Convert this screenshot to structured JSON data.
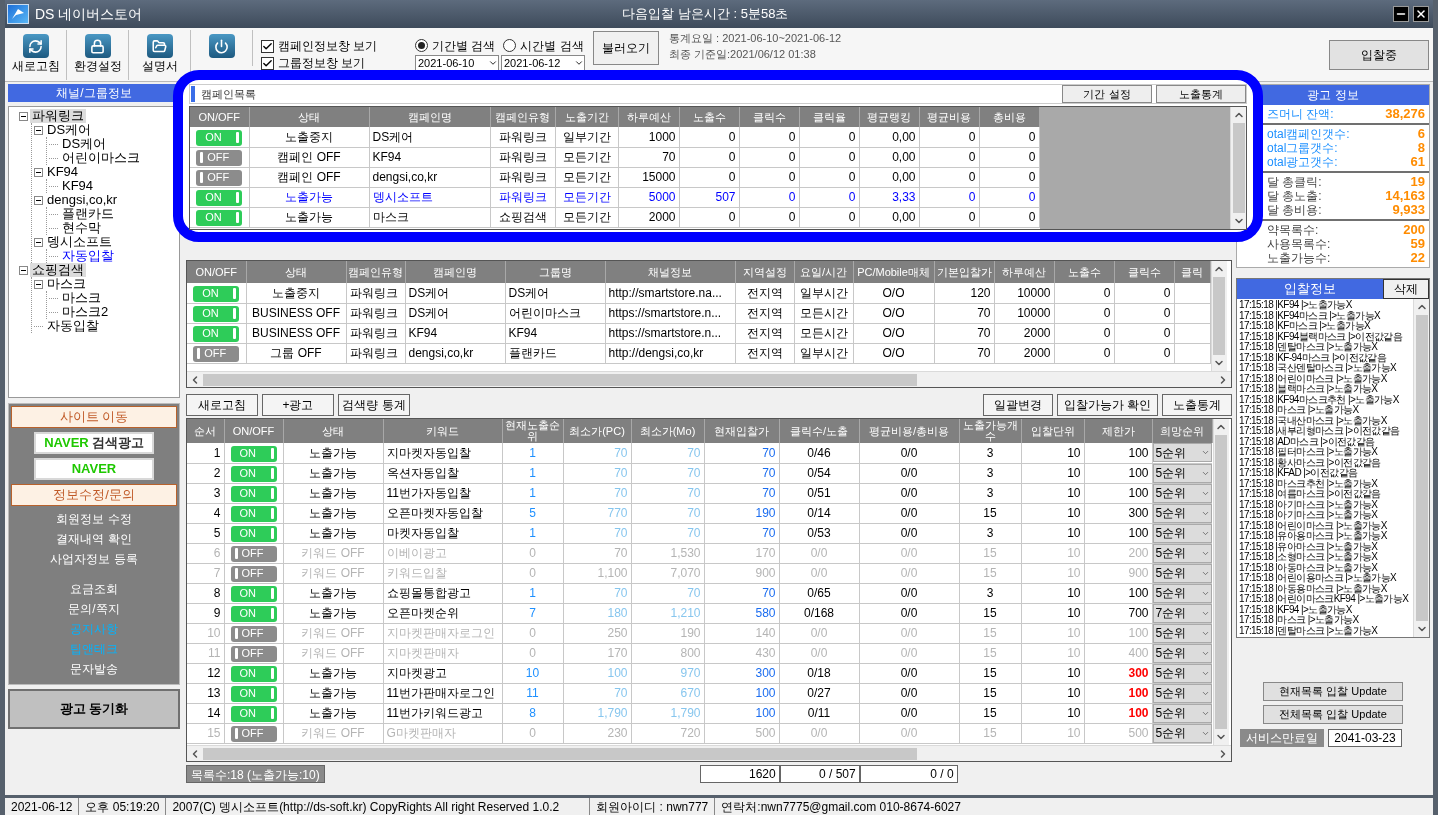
{
  "window": {
    "title": "DS 네이버스토어",
    "countdown": "다음입찰 남은시간 : 5분58초"
  },
  "toolbar": {
    "buttons": [
      {
        "kind": "refresh",
        "label": "새로고침"
      },
      {
        "kind": "settings",
        "label": "환경설정"
      },
      {
        "kind": "manual",
        "label": "설명서"
      },
      {
        "kind": "power"
      }
    ],
    "view_options": [
      {
        "label": "캠페인정보창 보기",
        "checked": true
      },
      {
        "label": "그룹정보창 보기",
        "checked": true
      }
    ],
    "search_mode": [
      {
        "label": "기간별 검색",
        "selected": true
      },
      {
        "label": "시간별 검색",
        "selected": false
      }
    ],
    "dates": [
      "2021-06-10",
      "2021-06-12"
    ],
    "load_button": "불러오기",
    "stats_period": "통계요일 : 2021-06-10~2021-06-12",
    "last_update": "최종 기준일:2021/06/12 01:38",
    "bid_status_button": "입찰중"
  },
  "sidebar": {
    "title": "채널/그룹정보",
    "tree": [
      {
        "label": "파워링크",
        "selected": false,
        "expanded": true,
        "children": [
          {
            "label": "DS케어",
            "selected": false,
            "expanded": true,
            "children": [
              {
                "label": "DS케어",
                "selected": false
              },
              {
                "label": "어린이마스크",
                "selected": false
              }
            ]
          },
          {
            "label": "KF94",
            "selected": false,
            "expanded": true,
            "children": [
              {
                "label": "KF94",
                "selected": false
              }
            ]
          },
          {
            "label": "dengsi,co,kr",
            "selected": false,
            "expanded": true,
            "children": [
              {
                "label": "플랜카드",
                "selected": false
              },
              {
                "label": "현수막",
                "selected": false
              }
            ]
          },
          {
            "label": "뎅시소프트",
            "selected": false,
            "expanded": true,
            "children": [
              {
                "label": "자동입찰",
                "selected": true
              }
            ]
          }
        ]
      },
      {
        "label": "쇼핑검색",
        "selected": false,
        "expanded": true,
        "children": [
          {
            "label": "마스크",
            "selected": false,
            "expanded": true,
            "children": [
              {
                "label": "마스크",
                "selected": false
              },
              {
                "label": "마스크2",
                "selected": false
              }
            ]
          },
          {
            "label": "자동입찰",
            "selected": false
          }
        ]
      }
    ]
  },
  "nav": {
    "site_header": "사이트 이동",
    "site_links": [
      {
        "brand": "NAVER",
        "suffix": "검색광고"
      },
      {
        "brand": "NAVER"
      }
    ],
    "info_header": "정보수정/문의",
    "link_groups": [
      [
        {
          "label": "회원정보 수정",
          "highlight": false
        },
        {
          "label": "결재내역 확인",
          "highlight": false
        },
        {
          "label": "사업자정보 등록",
          "highlight": false
        }
      ],
      [
        {
          "label": "요금조회",
          "highlight": false
        },
        {
          "label": "문의/쪽지",
          "highlight": false
        },
        {
          "label": "공지사항",
          "highlight": true
        },
        {
          "label": "팁앤테크",
          "highlight": true
        },
        {
          "label": "문자발송",
          "highlight": false
        }
      ]
    ],
    "sync_button": "광고 동기화"
  },
  "campaign_list": {
    "title": "캠페인목록",
    "buttons": [
      "기간 설정",
      "노출통계"
    ],
    "columns": [
      "ON/OFF",
      "상태",
      "캠페인명",
      "캠페인유형",
      "노출기간",
      "하루예산",
      "노출수",
      "클릭수",
      "클릭율",
      "평균랭킹",
      "평균비용",
      "총비용"
    ],
    "rows": [
      {
        "on": true,
        "selected": false,
        "cells": [
          "ON",
          "노출중지",
          "DS케어",
          "파워링크",
          "일부기간",
          "1000",
          "0",
          "0",
          "0",
          "0,00",
          "0",
          "0"
        ]
      },
      {
        "on": false,
        "selected": false,
        "cells": [
          "OFF",
          "캠페인 OFF",
          "KF94",
          "파워링크",
          "모든기간",
          "70",
          "0",
          "0",
          "0",
          "0,00",
          "0",
          "0"
        ]
      },
      {
        "on": false,
        "selected": false,
        "cells": [
          "OFF",
          "캠페인 OFF",
          "dengsi,co,kr",
          "파워링크",
          "모든기간",
          "15000",
          "0",
          "0",
          "0",
          "0,00",
          "0",
          "0"
        ]
      },
      {
        "on": true,
        "selected": true,
        "cells": [
          "ON",
          "노출가능",
          "뎅시소프트",
          "파워링크",
          "모든기간",
          "5000",
          "507",
          "0",
          "0",
          "3,33",
          "0",
          "0"
        ]
      },
      {
        "on": true,
        "selected": false,
        "cells": [
          "ON",
          "노출가능",
          "마스크",
          "쇼핑검색",
          "모든기간",
          "2000",
          "0",
          "0",
          "0",
          "0,00",
          "0",
          "0"
        ]
      }
    ]
  },
  "group_table": {
    "columns": [
      "ON/OFF",
      "상태",
      "캠페인유형",
      "캠페인명",
      "그룹명",
      "채널정보",
      "지역설정",
      "요일/시간",
      "PC/Mobile매체",
      "기본입찰가",
      "하루예산",
      "노출수",
      "클릭수",
      "클릭"
    ],
    "rows": [
      {
        "on": true,
        "cells": [
          "ON",
          "노출중지",
          "파워링크",
          "DS케어",
          "DS케어",
          "http://smartstore.na...",
          "전지역",
          "일부시간",
          "O/O",
          "120",
          "10000",
          "0",
          "0"
        ]
      },
      {
        "on": true,
        "cells": [
          "ON",
          "BUSINESS OFF",
          "파워링크",
          "DS케어",
          "어린이마스크",
          "https://smartstore.n...",
          "전지역",
          "모든시간",
          "O/O",
          "70",
          "10000",
          "0",
          "0"
        ]
      },
      {
        "on": true,
        "cells": [
          "ON",
          "BUSINESS OFF",
          "파워링크",
          "KF94",
          "KF94",
          "https://smartstore.n...",
          "전지역",
          "모든시간",
          "O/O",
          "70",
          "2000",
          "0",
          "0"
        ]
      },
      {
        "on": false,
        "cells": [
          "OFF",
          "그룹 OFF",
          "파워링크",
          "dengsi,co,kr",
          "플랜카드",
          "http://dengsi,co,kr",
          "전지역",
          "일부시간",
          "O/O",
          "70",
          "2000",
          "0",
          "0"
        ]
      }
    ]
  },
  "keyword_actions": {
    "left": [
      "새로고침",
      "+광고",
      "검색량 통계"
    ],
    "right": [
      "일괄변경",
      "입찰가능가 확인",
      "노출통계"
    ]
  },
  "keyword_table": {
    "columns": [
      "순서",
      "ON/OFF",
      "상태",
      "키워드",
      "현재노출순위",
      "최소가(PC)",
      "최소가(Mo)",
      "현재입찰가",
      "클릭수/노출",
      "평균비용/총비용",
      "노출가능개수",
      "입찰단위",
      "제한가",
      "희망순위"
    ],
    "rows": [
      {
        "on": true,
        "limit_alert": false,
        "cells": [
          "1",
          "ON",
          "노출가능",
          "지마켓자동입찰",
          "1",
          "70",
          "70",
          "70",
          "0/46",
          "0/0",
          "3",
          "10",
          "100",
          "5순위"
        ]
      },
      {
        "on": true,
        "limit_alert": false,
        "cells": [
          "2",
          "ON",
          "노출가능",
          "옥션자동입찰",
          "1",
          "70",
          "70",
          "70",
          "0/54",
          "0/0",
          "3",
          "10",
          "100",
          "5순위"
        ]
      },
      {
        "on": true,
        "limit_alert": false,
        "cells": [
          "3",
          "ON",
          "노출가능",
          "11번가자동입찰",
          "1",
          "70",
          "70",
          "70",
          "0/51",
          "0/0",
          "3",
          "10",
          "100",
          "5순위"
        ]
      },
      {
        "on": true,
        "limit_alert": false,
        "cells": [
          "4",
          "ON",
          "노출가능",
          "오픈마켓자동입찰",
          "5",
          "770",
          "70",
          "190",
          "0/14",
          "0/0",
          "15",
          "10",
          "300",
          "5순위"
        ]
      },
      {
        "on": true,
        "limit_alert": false,
        "cells": [
          "5",
          "ON",
          "노출가능",
          "마켓자동입찰",
          "1",
          "70",
          "70",
          "70",
          "0/53",
          "0/0",
          "3",
          "10",
          "100",
          "5순위"
        ]
      },
      {
        "on": false,
        "limit_alert": false,
        "cells": [
          "6",
          "OFF",
          "키워드 OFF",
          "이베이광고",
          "0",
          "70",
          "1,530",
          "170",
          "0/0",
          "0/0",
          "15",
          "10",
          "200",
          "5순위"
        ]
      },
      {
        "on": false,
        "limit_alert": false,
        "cells": [
          "7",
          "OFF",
          "키워드 OFF",
          "키워드입찰",
          "0",
          "1,100",
          "7,070",
          "900",
          "0/0",
          "0/0",
          "15",
          "10",
          "900",
          "5순위"
        ]
      },
      {
        "on": true,
        "limit_alert": false,
        "cells": [
          "8",
          "ON",
          "노출가능",
          "쇼핑몰통합광고",
          "1",
          "70",
          "70",
          "70",
          "0/65",
          "0/0",
          "3",
          "10",
          "100",
          "5순위"
        ]
      },
      {
        "on": true,
        "limit_alert": false,
        "cells": [
          "9",
          "ON",
          "노출가능",
          "오픈마켓순위",
          "7",
          "180",
          "1,210",
          "580",
          "0/168",
          "0/0",
          "15",
          "10",
          "700",
          "7순위"
        ]
      },
      {
        "on": false,
        "limit_alert": false,
        "cells": [
          "10",
          "OFF",
          "키워드 OFF",
          "지마켓판매자로그인",
          "0",
          "250",
          "190",
          "140",
          "0/0",
          "0/0",
          "15",
          "10",
          "100",
          "5순위"
        ]
      },
      {
        "on": false,
        "limit_alert": false,
        "cells": [
          "11",
          "OFF",
          "키워드 OFF",
          "지마켓판매자",
          "0",
          "170",
          "800",
          "430",
          "0/0",
          "0/0",
          "15",
          "10",
          "400",
          "5순위"
        ]
      },
      {
        "on": true,
        "limit_alert": true,
        "cells": [
          "12",
          "ON",
          "노출가능",
          "지마켓광고",
          "10",
          "100",
          "970",
          "300",
          "0/18",
          "0/0",
          "15",
          "10",
          "300",
          "5순위"
        ]
      },
      {
        "on": true,
        "limit_alert": true,
        "cells": [
          "13",
          "ON",
          "노출가능",
          "11번가판매자로그인",
          "11",
          "70",
          "670",
          "100",
          "0/27",
          "0/0",
          "15",
          "10",
          "100",
          "5순위"
        ]
      },
      {
        "on": true,
        "limit_alert": true,
        "cells": [
          "14",
          "ON",
          "노출가능",
          "11번가키워드광고",
          "8",
          "1,790",
          "1,790",
          "100",
          "0/11",
          "0/0",
          "15",
          "10",
          "100",
          "5순위"
        ]
      },
      {
        "on": false,
        "limit_alert": false,
        "cells": [
          "15",
          "OFF",
          "키워드 OFF",
          "G마켓판매자",
          "0",
          "230",
          "720",
          "500",
          "0/0",
          "0/0",
          "15",
          "10",
          "500",
          "5순위"
        ]
      }
    ]
  },
  "summary": {
    "count": "목록수:18 (노출가능:10)",
    "totals": [
      "1620",
      "0 / 507",
      "0 / 0"
    ]
  },
  "ad_info": {
    "title": "광고 정보",
    "groups": [
      [
        {
          "label": "즈머니 잔액:",
          "value": "38,276"
        }
      ],
      [
        {
          "label": "otal캠페인갯수:",
          "value": "6"
        },
        {
          "label": "otal그룹갯수:",
          "value": "8"
        },
        {
          "label": "otal광고갯수:",
          "value": "61"
        }
      ],
      [
        {
          "label": "달 총클릭:",
          "value": "19"
        },
        {
          "label": "달 총노출:",
          "value": "14,163"
        },
        {
          "label": "달 총비용:",
          "value": "9,933"
        }
      ],
      [
        {
          "label": "약목록수:",
          "value": "200"
        },
        {
          "label": "사용목록수:",
          "value": "59"
        },
        {
          "label": "노출가능수:",
          "value": "22"
        }
      ]
    ]
  },
  "bid_log": {
    "title": "입찰정보",
    "delete_button": "삭제",
    "lines": [
      "17:15:18 |KF94 |>노출가능X",
      "17:15:18 |KF94마스크 |>노출가능X",
      "17:15:18 |KF마스크 |>노출가능X",
      "17:15:18 |KF94블랙마스크 |>이전값같음",
      "17:15:18 |덴탈마스크 |>노출가능X",
      "17:15:18 |KF-94마스크 |>이전값같음",
      "17:15:18 |국산덴탈마스크 |>노출가능X",
      "17:15:18 |어린이마스크 |>노출가능X",
      "17:15:18 |블랙마스크 |>노출가능X",
      "17:15:18 |KF94마스크추천 |>노출가능X",
      "17:15:18 |마스크 |>노출가능X",
      "17:15:18 |국내산마스크 |>노출가능X",
      "17:15:18 |새부리형마스크 |>이전값같음",
      "17:15:18 |AD마스크 |>이전값같음",
      "17:15:18 |필터마스크 |>노출가능X",
      "17:15:18 |황사마스크 |>이전값같음",
      "17:15:18 |KFAD |>이전값같음",
      "17:15:18 |마스크추천 |>노출가능X",
      "17:15:18 |여름마스크 |>이전값같음",
      "17:15:18 |아기마스크 |>노출가능X",
      "17:15:18 |아기마스크 |>노출가능X",
      "17:15:18 |어린이마스크 |>노출가능X",
      "17:15:18 |유아용마스크 |>노출가능X",
      "17:15:18 |유아마스크 |>노출가능X",
      "17:15:18 |소형마스크 |>노출가능X",
      "17:15:18 |아동마스크 |>노출가능X",
      "17:15:18 |어린이용마스크 |>노출가능X",
      "17:15:18 |아동용마스크 |>노출가능X",
      "17:15:18 |어린이마스크KF94 |>노출가능X",
      "17:15:18 |KF94 |>노출가능X",
      "17:15:18 |마스크 |>노출가능X",
      "17:15:18 |덴탈마스크 |>노출가능X"
    ]
  },
  "update_buttons": [
    "현재목록 입찰 Update",
    "전체목록 입찰 Update"
  ],
  "expiry": {
    "label": "서비스만료일",
    "value": "2041-03-23"
  },
  "status_bar": [
    "2021-06-12",
    "오후 05:19:20",
    "2007(C) 뎅시소프트(http://ds-soft.kr) CopyRights All right Reserved 1.0.2",
    "회원아이디 : nwn777",
    "연락처:nwn7775@gmail.com 010-8674-6027"
  ]
}
